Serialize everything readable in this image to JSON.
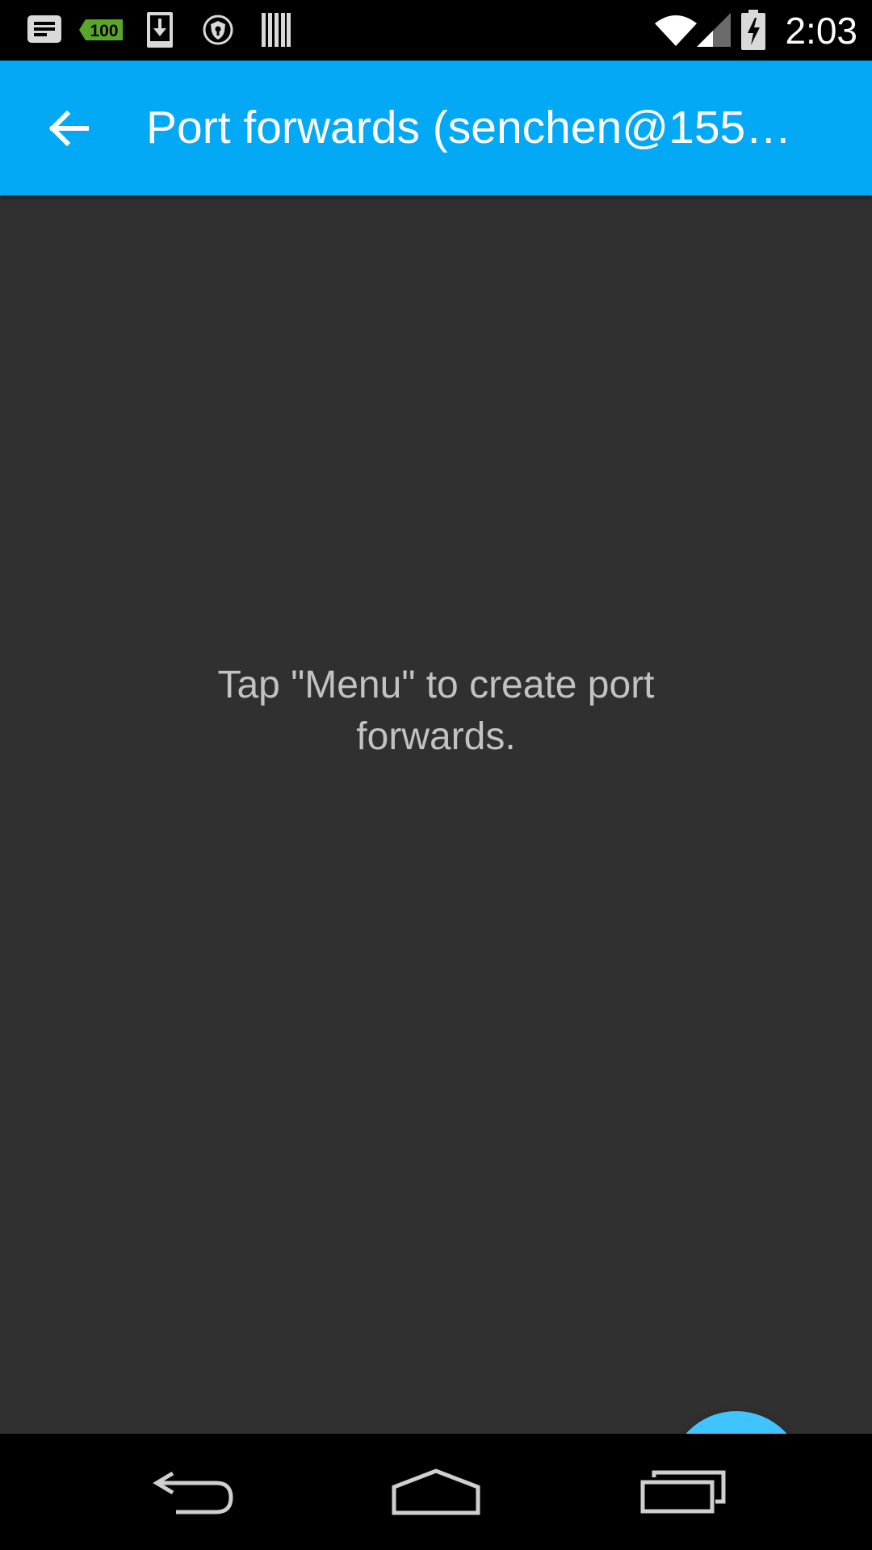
{
  "status_bar": {
    "time": "2:03",
    "notification_icons": [
      "message-icon",
      "battery-100-icon",
      "download-icon",
      "vpn-shield-icon",
      "barcode-icon"
    ],
    "system_icons": [
      "wifi-icon",
      "signal-icon",
      "battery-charging-icon"
    ],
    "badge_text": "100"
  },
  "app_bar": {
    "title": "Port forwards (senchen@155…",
    "back_icon": "arrow-back-icon",
    "color": "#03a9f4"
  },
  "content": {
    "empty_message": "Tap \"Menu\" to create port forwards.",
    "background": "#303030"
  },
  "fab": {
    "icon": "plus-icon",
    "color": "#40c4ff"
  },
  "nav_bar": {
    "buttons": [
      "back-nav-icon",
      "home-nav-icon",
      "recents-nav-icon"
    ]
  }
}
